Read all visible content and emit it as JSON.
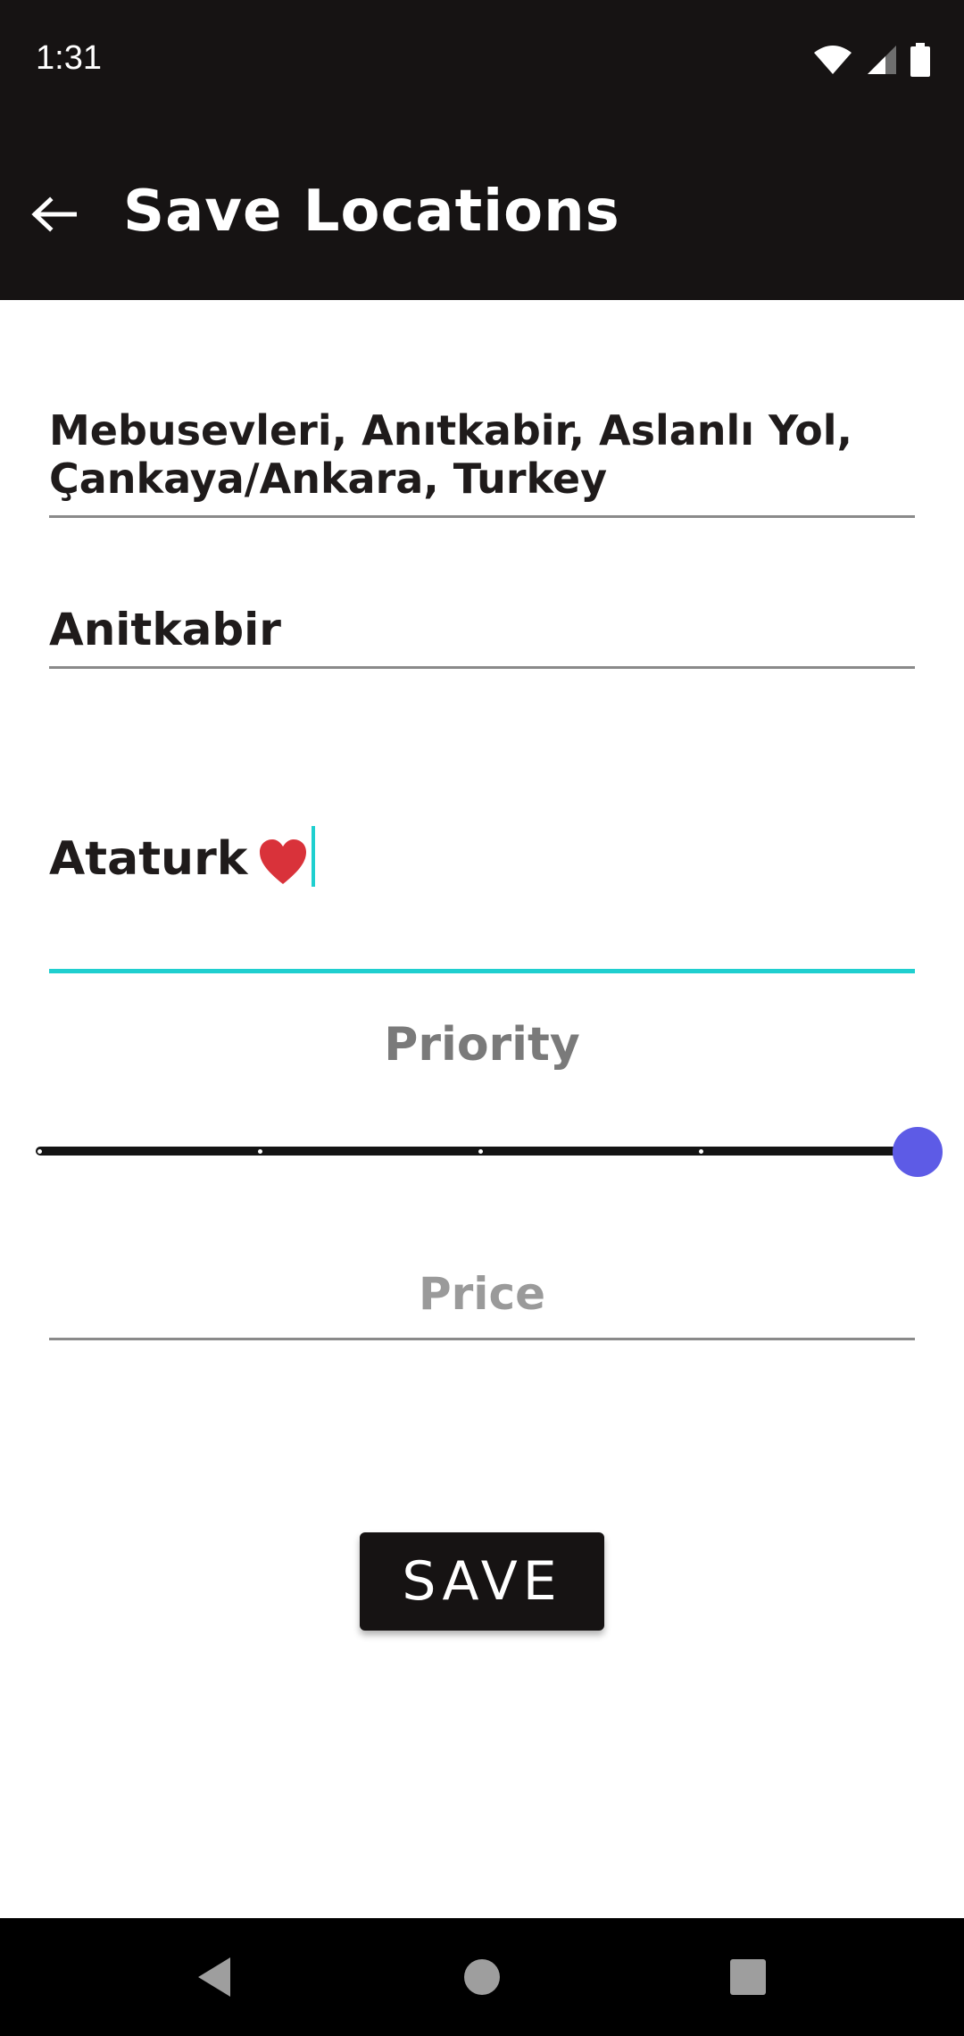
{
  "status_bar": {
    "time": "1:31",
    "icons": [
      "wifi-icon",
      "cellular-signal-icon",
      "battery-icon"
    ]
  },
  "app_bar": {
    "title": "Save Locations",
    "back_icon": "arrow-left-icon"
  },
  "form": {
    "address_value": "Mebusevleri, Anıtkabir, Aslanlı Yol, Çankaya/Ankara, Turkey",
    "name_value": "Anitkabir",
    "note_value": "Ataturk",
    "note_emoji": "heart-emoji",
    "priority_label": "Priority",
    "priority": {
      "min": 0,
      "max": 4,
      "value": 4,
      "steps": 5
    },
    "price_placeholder": "Price",
    "save_label": "SAVE"
  },
  "colors": {
    "bar_background": "#161313",
    "accent": "#1fcfcf",
    "slider_thumb": "#5d5be6",
    "heart": "#d9323a"
  },
  "nav_bar": {
    "icons": [
      "back-triangle-icon",
      "home-circle-icon",
      "recents-square-icon"
    ]
  }
}
